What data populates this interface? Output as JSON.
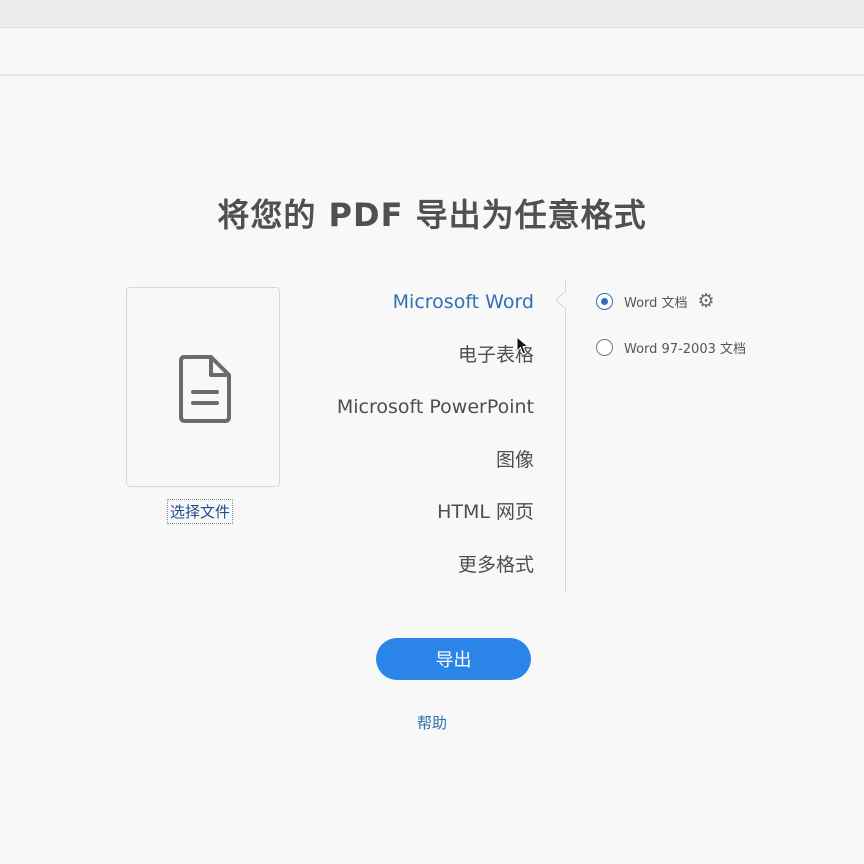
{
  "title": "将您的 PDF 导出为任意格式",
  "file_panel": {
    "icon": "document-icon",
    "select_label": "选择文件"
  },
  "formats": [
    {
      "label": "Microsoft Word",
      "selected": true
    },
    {
      "label": "电子表格",
      "selected": false
    },
    {
      "label": "Microsoft PowerPoint",
      "selected": false
    },
    {
      "label": "图像",
      "selected": false
    },
    {
      "label": "HTML 网页",
      "selected": false
    },
    {
      "label": "更多格式",
      "selected": false
    }
  ],
  "options": [
    {
      "label": "Word 文档",
      "checked": true,
      "settings_icon": "gear-icon"
    },
    {
      "label": "Word 97-2003 文档",
      "checked": false
    }
  ],
  "export_label": "导出",
  "help_label": "帮助",
  "colors": {
    "accent": "#2b84e8",
    "link": "#2f6fb6"
  }
}
